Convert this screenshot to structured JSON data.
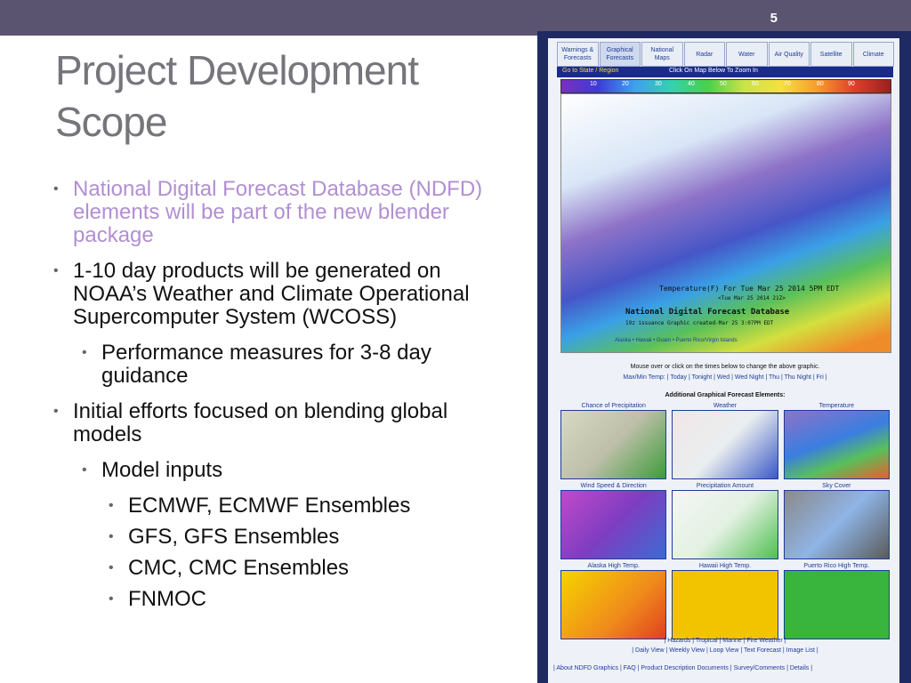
{
  "slide": {
    "number": "5",
    "title_line1": "Project Development",
    "title_line2": "Scope"
  },
  "bullets": [
    {
      "text": "National Digital Forecast Database (NDFD) elements will be part of the new blender package"
    },
    {
      "text": "1-10 day products will be generated on NOAA’s Weather and Climate Operational Supercomputer System (WCOSS)"
    },
    {
      "text": "Performance measures for 3-8 day guidance"
    },
    {
      "text": "Initial efforts focused on blending global models"
    },
    {
      "text": "Model inputs"
    },
    {
      "text": "ECMWF, ECMWF Ensembles"
    },
    {
      "text": "GFS, GFS Ensembles"
    },
    {
      "text": "CMC, CMC Ensembles"
    },
    {
      "text": "FNMOC"
    }
  ],
  "screenshot": {
    "tabs": [
      "Warnings & Forecasts",
      "Graphical Forecasts",
      "National Maps",
      "Radar",
      "Water",
      "Air Quality",
      "Satellite",
      "Climate"
    ],
    "nav_left": "Go to State / Region",
    "nav_center": "Click On Map Below To Zoom In",
    "scale_ticks": [
      "10",
      "20",
      "30",
      "40",
      "50",
      "60",
      "70",
      "80",
      "90"
    ],
    "map_title": "Temperature(F) For Tue Mar 25 2014  5PM EDT",
    "map_subtitle": "<Tue Mar 25 2014 21Z>",
    "map_db": "National Digital Forecast Database",
    "map_issuance": "19z issuance    Graphic created-Mar 25  3:07PM EDT",
    "regions": "Alaska  •  Hawaii  •  Guam  •  Puerto Rico/Virgin Islands",
    "mouse_note": "Mouse over or click on the times below to change the above graphic.",
    "times": "Max/Min Temp:  | Today | Tonight | Wed | Wed Night | Thu | Thu Night | Fri |",
    "additional": "Additional Graphical Forecast Elements:",
    "cells": [
      {
        "label": "Chance of Precipitation"
      },
      {
        "label": "Weather"
      },
      {
        "label": "Temperature"
      },
      {
        "label": "Wind Speed & Direction"
      },
      {
        "label": "Precipitation Amount"
      },
      {
        "label": "Sky Cover"
      },
      {
        "label": "Alaska High Temp."
      },
      {
        "label": "Hawaii High Temp."
      },
      {
        "label": "Puerto Rico High Temp."
      }
    ],
    "footer_line1": "| Hazards | Tropical | Marine | Fire Weather |",
    "footer_line2": "| Daily View | Weekly View | Loop View | Text Forecast | Image List |",
    "bottom_links": "| About NDFD Graphics | FAQ | Product Description Documents | Survey/Comments | Details |"
  },
  "colors": {
    "topbar": "#5b5470",
    "title": "#75757b",
    "accent_bullet": "#b18fd1",
    "screenshot_frame": "#1f2a63"
  }
}
